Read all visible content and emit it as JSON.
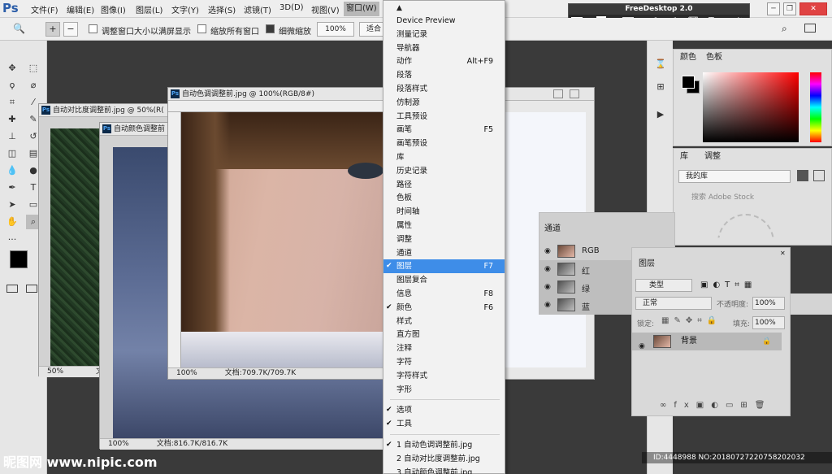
{
  "app": {
    "logo": "Ps"
  },
  "menubar": {
    "items": [
      "文件(F)",
      "编辑(E)",
      "图像(I)",
      "图层(L)",
      "文字(Y)",
      "选择(S)",
      "滤镜(T)",
      "3D(D)",
      "视图(V)",
      "窗口(W)"
    ]
  },
  "freedesktop": {
    "title": "FreeDesktop 2.0",
    "value": "3"
  },
  "options": {
    "resize_windows": "调整窗口大小以满屏显示",
    "zoom_all": "缩放所有窗口",
    "scrubby_zoom": "细微缩放",
    "zoom_value": "100%",
    "fit_label": "适合"
  },
  "documents": [
    {
      "title": "自动对比度调整前.jpg @ 50%(R(",
      "zoom": "50%",
      "status": "文"
    },
    {
      "title": "自动颜色调整前",
      "zoom": "100%",
      "status": "文档:816.7K/816.7K"
    },
    {
      "title": "自动色调调整前.jpg @ 100%(RGB/8#)",
      "zoom": "100%",
      "status": "文档:709.7K/709.7K"
    }
  ],
  "window_menu": {
    "items": [
      {
        "label": "Device Preview",
        "shortcut": "",
        "checked": false
      },
      {
        "label": "测量记录",
        "shortcut": "",
        "checked": false
      },
      {
        "label": "导航器",
        "shortcut": "",
        "checked": false
      },
      {
        "label": "动作",
        "shortcut": "Alt+F9",
        "checked": false
      },
      {
        "label": "段落",
        "shortcut": "",
        "checked": false
      },
      {
        "label": "段落样式",
        "shortcut": "",
        "checked": false
      },
      {
        "label": "仿制源",
        "shortcut": "",
        "checked": false
      },
      {
        "label": "工具预设",
        "shortcut": "",
        "checked": false
      },
      {
        "label": "画笔",
        "shortcut": "F5",
        "checked": false
      },
      {
        "label": "画笔预设",
        "shortcut": "",
        "checked": false
      },
      {
        "label": "库",
        "shortcut": "",
        "checked": false
      },
      {
        "label": "历史记录",
        "shortcut": "",
        "checked": false
      },
      {
        "label": "路径",
        "shortcut": "",
        "checked": false
      },
      {
        "label": "色板",
        "shortcut": "",
        "checked": false
      },
      {
        "label": "时间轴",
        "shortcut": "",
        "checked": false
      },
      {
        "label": "属性",
        "shortcut": "",
        "checked": false
      },
      {
        "label": "调整",
        "shortcut": "",
        "checked": false
      },
      {
        "label": "通道",
        "shortcut": "",
        "checked": false
      },
      {
        "label": "图层",
        "shortcut": "F7",
        "checked": true
      },
      {
        "label": "图层复合",
        "shortcut": "",
        "checked": false
      },
      {
        "label": "信息",
        "shortcut": "F8",
        "checked": false
      },
      {
        "label": "颜色",
        "shortcut": "F6",
        "checked": true
      },
      {
        "label": "样式",
        "shortcut": "",
        "checked": false
      },
      {
        "label": "直方图",
        "shortcut": "",
        "checked": false
      },
      {
        "label": "注释",
        "shortcut": "",
        "checked": false
      },
      {
        "label": "字符",
        "shortcut": "",
        "checked": false
      },
      {
        "label": "字符样式",
        "shortcut": "",
        "checked": false
      },
      {
        "label": "字形",
        "shortcut": "",
        "checked": false
      }
    ],
    "bottom_items": [
      {
        "label": "选项",
        "checked": true
      },
      {
        "label": "工具",
        "checked": true
      }
    ],
    "open_docs": [
      {
        "label": "1 自动色调调整前.jpg",
        "checked": true
      },
      {
        "label": "2 自动对比度调整前.jpg",
        "checked": false
      },
      {
        "label": "3 自动颜色调整前.jpg",
        "checked": false
      }
    ]
  },
  "color_panel": {
    "tabs": [
      "颜色",
      "色板"
    ],
    "fg_color": "#000000",
    "bg_color": "#ffffff"
  },
  "library_panel": {
    "tabs": [
      "库",
      "调整"
    ],
    "library_name": "我的库",
    "search_placeholder": "搜索 Adobe Stock"
  },
  "channels_panel": {
    "title": "通道",
    "channels": [
      "RGB",
      "红",
      "绿",
      "蓝"
    ]
  },
  "layers_panel": {
    "title": "图层",
    "kind_filter": "类型",
    "blend_mode": "正常",
    "opacity_label": "不透明度:",
    "opacity_value": "100%",
    "lock_label": "锁定:",
    "fill_label": "填充:",
    "fill_value": "100%",
    "layers": [
      {
        "name": "背景",
        "locked": true
      }
    ],
    "footer_fx": "fx"
  },
  "watermark": {
    "site": "昵图网 www.nipic.com",
    "id": "ID:4448988 NO:20180727220758202032"
  },
  "colors": {
    "accent": "#3e8de8",
    "menu_bg": "#f2f2f2",
    "chrome": "#eeeeee"
  }
}
